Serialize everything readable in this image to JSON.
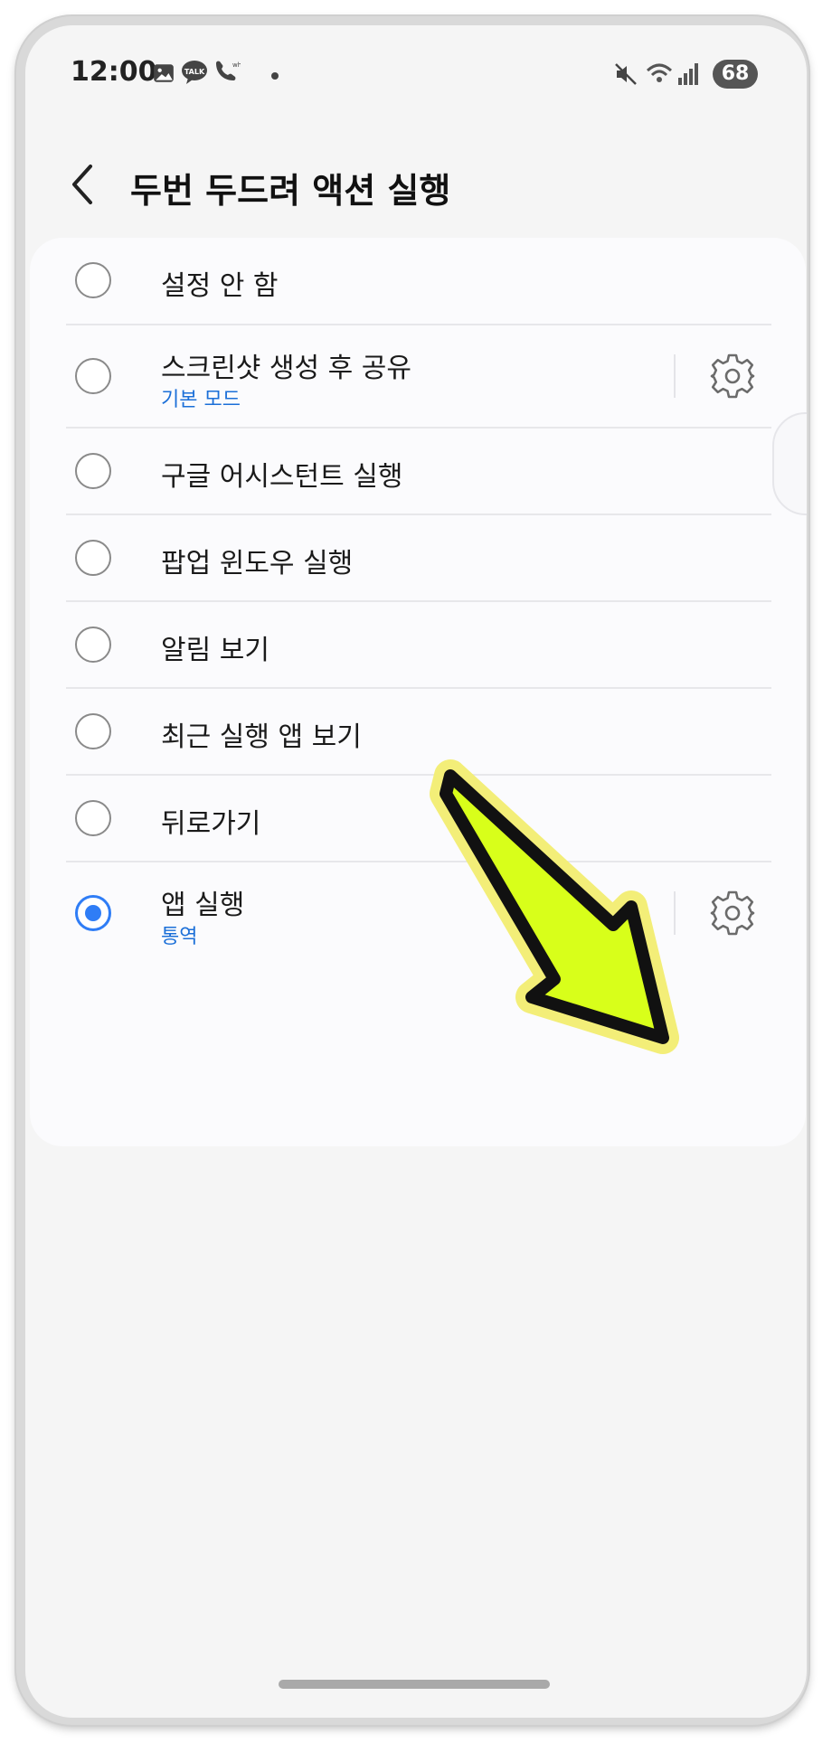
{
  "status_bar": {
    "time": "12:00",
    "icons": [
      "image-icon",
      "talk-icon",
      "whowho-call-icon",
      "dot",
      "mute-icon",
      "wifi-icon",
      "signal-icon"
    ],
    "battery": "68"
  },
  "header": {
    "title": "두번 두드려 액션 실행",
    "back_icon": "chevron-left-icon"
  },
  "options": [
    {
      "label": "설정 안 함",
      "sub": null,
      "selected": false,
      "has_settings": false
    },
    {
      "label": "스크린샷 생성 후 공유",
      "sub": "기본 모드",
      "selected": false,
      "has_settings": true
    },
    {
      "label": "구글 어시스턴트 실행",
      "sub": null,
      "selected": false,
      "has_settings": false
    },
    {
      "label": "팝업 윈도우 실행",
      "sub": null,
      "selected": false,
      "has_settings": false
    },
    {
      "label": "알림 보기",
      "sub": null,
      "selected": false,
      "has_settings": false
    },
    {
      "label": "최근 실행 앱 보기",
      "sub": null,
      "selected": false,
      "has_settings": false
    },
    {
      "label": "뒤로가기",
      "sub": null,
      "selected": false,
      "has_settings": false
    },
    {
      "label": "앱 실행",
      "sub": "통역",
      "selected": true,
      "has_settings": true
    }
  ],
  "colors": {
    "accent": "#2f7df6",
    "sub_text": "#1b6fd8",
    "arrow_fill": "#d8ff1a",
    "arrow_glow": "#f6f07a"
  }
}
